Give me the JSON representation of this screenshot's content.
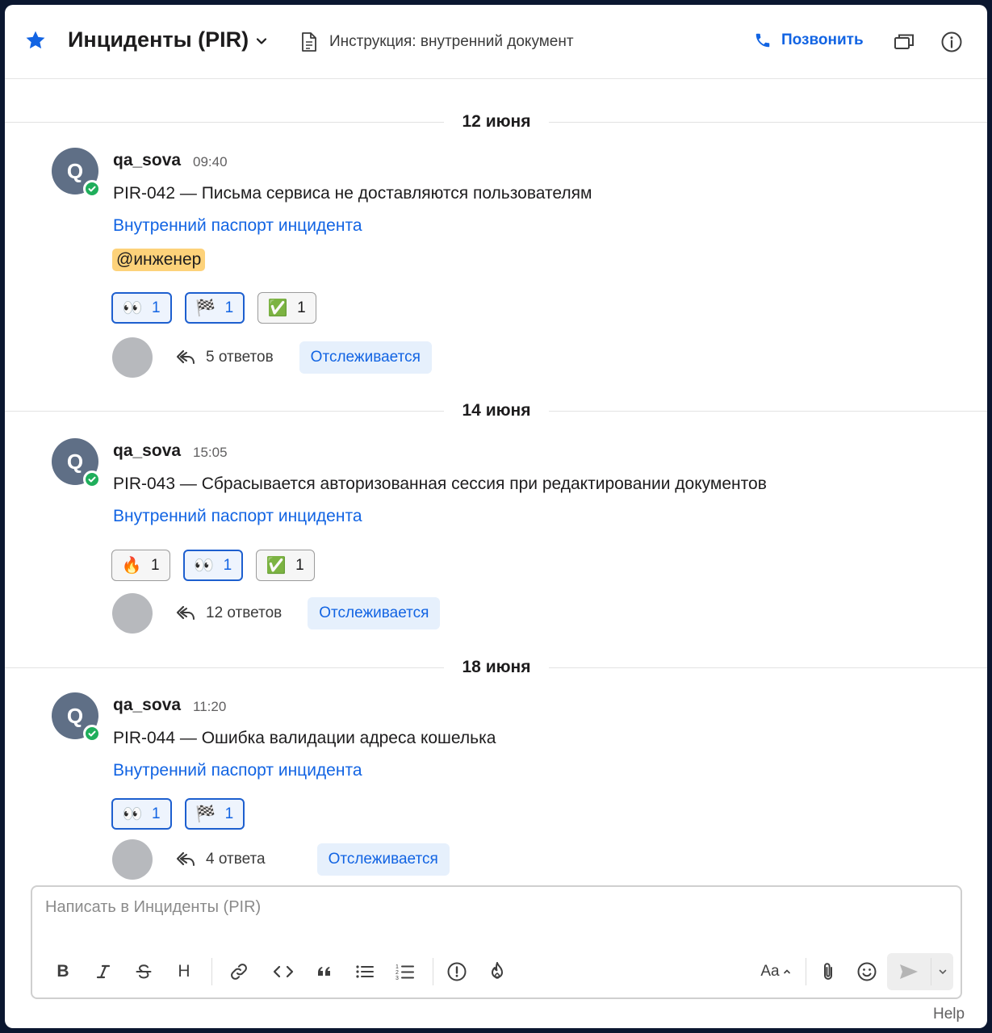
{
  "header": {
    "channel_name": "Инциденты (PIR)",
    "doc_label": "Инструкция: внутренний документ",
    "call_label": "Позвонить"
  },
  "days": [
    {
      "date": "12 июня",
      "message": {
        "avatar_letter": "Q",
        "author": "qa_sova",
        "time": "09:40",
        "text": "PIR-042 — Письма сервиса не доставляются пользователям",
        "link": "Внутренний паспорт инцидента",
        "mention": "@инженер",
        "reactions": [
          {
            "emoji": "👀",
            "count": "1",
            "mine": true
          },
          {
            "emoji": "🏁",
            "count": "1",
            "mine": true
          },
          {
            "emoji": "✅",
            "count": "1",
            "mine": false
          }
        ],
        "replies": "5 ответов",
        "follow": "Отслеживается"
      }
    },
    {
      "date": "14 июня",
      "message": {
        "avatar_letter": "Q",
        "author": "qa_sova",
        "time": "15:05",
        "text": "PIR-043 — Сбрасывается авторизованная сессия при редактировании документов",
        "link": "Внутренний паспорт инцидента",
        "reactions": [
          {
            "emoji": "🔥",
            "count": "1",
            "mine": false
          },
          {
            "emoji": "👀",
            "count": "1",
            "mine": true
          },
          {
            "emoji": "✅",
            "count": "1",
            "mine": false
          }
        ],
        "replies": "12 ответов",
        "follow": "Отслеживается"
      }
    },
    {
      "date": "18 июня",
      "message": {
        "avatar_letter": "Q",
        "author": "qa_sova",
        "time": "11:20",
        "text": "PIR-044 — Ошибка валидации адреса кошелька",
        "link": "Внутренний паспорт инцидента",
        "reactions": [
          {
            "emoji": "👀",
            "count": "1",
            "mine": true
          },
          {
            "emoji": "🏁",
            "count": "1",
            "mine": true
          }
        ],
        "replies": "4 ответа",
        "follow": "Отслеживается"
      }
    }
  ],
  "composer": {
    "placeholder": "Написать в Инциденты (PIR)",
    "value": "",
    "toolbar": {
      "bold": "B",
      "heading": "H",
      "text_size": "Aa"
    }
  },
  "footer": {
    "help": "Help"
  },
  "colors": {
    "accent": "#1264e3",
    "mention_bg": "#fdd27a",
    "presence": "#1fae5b",
    "avatar": "#5f6f86"
  }
}
